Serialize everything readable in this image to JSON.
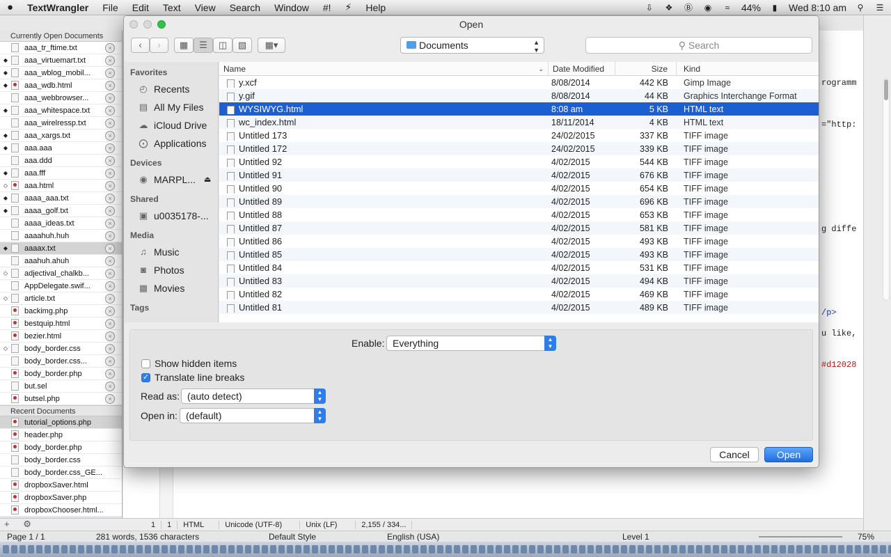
{
  "menubar": {
    "apple": "",
    "app": "TextWrangler",
    "items": [
      "File",
      "Edit",
      "Text",
      "View",
      "Search",
      "Window",
      "#!",
      "",
      "Help"
    ],
    "battery": "44%",
    "clock": "Wed 8:10 am"
  },
  "sidebar": {
    "open_header": "Currently Open Documents",
    "open_docs": [
      {
        "name": "aaa_tr_ftime.txt",
        "dot": ""
      },
      {
        "name": "aaa_virtuemart.txt",
        "dot": "◆"
      },
      {
        "name": "aaa_wblog_mobil...",
        "dot": "◆"
      },
      {
        "name": "aaa_wdb.html",
        "dot": "◆"
      },
      {
        "name": "aaa_webbrowser...",
        "dot": ""
      },
      {
        "name": "aaa_whitespace.txt",
        "dot": "◆"
      },
      {
        "name": "aaa_wirelressp.txt",
        "dot": ""
      },
      {
        "name": "aaa_xargs.txt",
        "dot": "◆"
      },
      {
        "name": "aaa.aaa",
        "dot": "◆"
      },
      {
        "name": "aaa.ddd",
        "dot": ""
      },
      {
        "name": "aaa.fff",
        "dot": "◆"
      },
      {
        "name": "aaa.html",
        "dot": "◇"
      },
      {
        "name": "aaaa_aaa.txt",
        "dot": "◆"
      },
      {
        "name": "aaaa_golf.txt",
        "dot": "◆"
      },
      {
        "name": "aaaa_ideas.txt",
        "dot": ""
      },
      {
        "name": "aaaahuh.huh",
        "dot": ""
      },
      {
        "name": "aaaax.txt",
        "dot": "◆"
      },
      {
        "name": "aaahuh.ahuh",
        "dot": ""
      },
      {
        "name": "adjectival_chalkb...",
        "dot": "◇"
      },
      {
        "name": "AppDelegate.swif...",
        "dot": ""
      },
      {
        "name": "article.txt",
        "dot": "◇"
      },
      {
        "name": "backimg.php",
        "dot": ""
      },
      {
        "name": "bestquip.html",
        "dot": ""
      },
      {
        "name": "bezier.html",
        "dot": ""
      },
      {
        "name": "body_border.css",
        "dot": "◇"
      },
      {
        "name": "body_border.css...",
        "dot": ""
      },
      {
        "name": "body_border.php",
        "dot": ""
      },
      {
        "name": "but.sel",
        "dot": ""
      },
      {
        "name": "butsel.php",
        "dot": ""
      }
    ],
    "recent_header": "Recent Documents",
    "recent_docs": [
      "tutorial_options.php",
      "header.php",
      "body_border.php",
      "body_border.css",
      "body_border.css_GE...",
      "dropboxSaver.html",
      "dropboxSaver.php",
      "dropboxChooser.html..."
    ],
    "add": "+",
    "gear": "⚙"
  },
  "editor": {
    "snippets": [
      "rogramm",
      "=\"http:",
      "g diffe",
      "/p>",
      "u like,",
      "#d12028"
    ]
  },
  "status1": {
    "line": "1",
    "col": "1",
    "lang": "HTML",
    "encoding": "Unicode (UTF-8)",
    "linebreaks": "Unix (LF)",
    "count": "2,155 / 334..."
  },
  "status2": {
    "page": "Page 1 / 1",
    "words": "281 words, 1536 characters",
    "style": "Default Style",
    "lang": "English (USA)",
    "level": "Level 1",
    "zoom": "75%"
  },
  "dialog": {
    "title": "Open",
    "location": "Documents",
    "search_placeholder": "Search",
    "favorites_header": "Favorites",
    "favorites": [
      {
        "label": "Recents",
        "icon": "clock-icon"
      },
      {
        "label": "All My Files",
        "icon": "files-icon"
      },
      {
        "label": "iCloud Drive",
        "icon": "cloud-icon"
      },
      {
        "label": "Applications",
        "icon": "apps-icon"
      }
    ],
    "devices_header": "Devices",
    "devices": [
      {
        "label": "MARPL...",
        "icon": "disk-icon"
      }
    ],
    "shared_header": "Shared",
    "shared": [
      {
        "label": "u0035178-...",
        "icon": "computer-icon"
      }
    ],
    "media_header": "Media",
    "media": [
      {
        "label": "Music",
        "icon": "music-icon"
      },
      {
        "label": "Photos",
        "icon": "camera-icon"
      },
      {
        "label": "Movies",
        "icon": "film-icon"
      }
    ],
    "tags_header": "Tags",
    "columns": {
      "name": "Name",
      "date": "Date Modified",
      "size": "Size",
      "kind": "Kind"
    },
    "files": [
      {
        "name": "y.xcf",
        "date": "8/08/2014",
        "size": "442 KB",
        "kind": "Gimp Image"
      },
      {
        "name": "y.gif",
        "date": "8/08/2014",
        "size": "44 KB",
        "kind": "Graphics Interchange Format"
      },
      {
        "name": "WYSIWYG.html",
        "date": "8:08 am",
        "size": "5 KB",
        "kind": "HTML text",
        "selected": true
      },
      {
        "name": "wc_index.html",
        "date": "18/11/2014",
        "size": "4 KB",
        "kind": "HTML text"
      },
      {
        "name": "Untitled 173",
        "date": "24/02/2015",
        "size": "337 KB",
        "kind": "TIFF image"
      },
      {
        "name": "Untitled 172",
        "date": "24/02/2015",
        "size": "339 KB",
        "kind": "TIFF image"
      },
      {
        "name": "Untitled 92",
        "date": "4/02/2015",
        "size": "544 KB",
        "kind": "TIFF image"
      },
      {
        "name": "Untitled 91",
        "date": "4/02/2015",
        "size": "676 KB",
        "kind": "TIFF image"
      },
      {
        "name": "Untitled 90",
        "date": "4/02/2015",
        "size": "654 KB",
        "kind": "TIFF image"
      },
      {
        "name": "Untitled 89",
        "date": "4/02/2015",
        "size": "696 KB",
        "kind": "TIFF image"
      },
      {
        "name": "Untitled 88",
        "date": "4/02/2015",
        "size": "653 KB",
        "kind": "TIFF image"
      },
      {
        "name": "Untitled 87",
        "date": "4/02/2015",
        "size": "581 KB",
        "kind": "TIFF image"
      },
      {
        "name": "Untitled 86",
        "date": "4/02/2015",
        "size": "493 KB",
        "kind": "TIFF image"
      },
      {
        "name": "Untitled 85",
        "date": "4/02/2015",
        "size": "493 KB",
        "kind": "TIFF image"
      },
      {
        "name": "Untitled 84",
        "date": "4/02/2015",
        "size": "531 KB",
        "kind": "TIFF image"
      },
      {
        "name": "Untitled 83",
        "date": "4/02/2015",
        "size": "494 KB",
        "kind": "TIFF image"
      },
      {
        "name": "Untitled 82",
        "date": "4/02/2015",
        "size": "469 KB",
        "kind": "TIFF image"
      },
      {
        "name": "Untitled 81",
        "date": "4/02/2015",
        "size": "489 KB",
        "kind": "TIFF image"
      }
    ],
    "enable_label": "Enable:",
    "enable_value": "Everything",
    "show_hidden": "Show hidden items",
    "show_hidden_checked": false,
    "translate": "Translate line breaks",
    "translate_checked": true,
    "read_as_label": "Read as:",
    "read_as_value": "(auto detect)",
    "open_in_label": "Open in:",
    "open_in_value": "(default)",
    "cancel": "Cancel",
    "open": "Open"
  }
}
